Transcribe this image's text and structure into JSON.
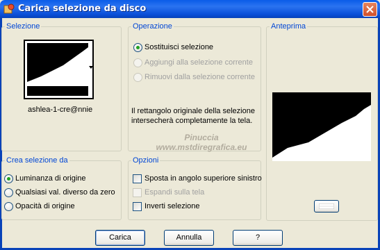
{
  "window": {
    "title": "Carica selezione da disco"
  },
  "selezione": {
    "label": "Selezione",
    "file_name": "ashlea-1-cre@nnie"
  },
  "operazione": {
    "label": "Operazione",
    "options": [
      {
        "label": "Sostituisci selezione",
        "checked": true,
        "enabled": true
      },
      {
        "label": "Aggiungi alla selezione corrente",
        "checked": false,
        "enabled": false
      },
      {
        "label": "Rimuovi dalla selezione corrente",
        "checked": false,
        "enabled": false
      }
    ],
    "info_line1": "Il rettangolo originale della selezione",
    "info_line2": "intersecherà completamente la tela."
  },
  "anteprima": {
    "label": "Anteprima"
  },
  "crea_da": {
    "label": "Crea selezione da",
    "options": [
      {
        "label": "Luminanza di origine",
        "checked": true
      },
      {
        "label": "Qualsiasi val. diverso da zero",
        "checked": false
      },
      {
        "label": "Opacità di origine",
        "checked": false
      }
    ]
  },
  "opzioni": {
    "label": "Opzioni",
    "items": [
      {
        "label": "Sposta in angolo superiore sinistro",
        "checked": false,
        "enabled": true
      },
      {
        "label": "Espandi sulla tela",
        "checked": false,
        "enabled": false
      },
      {
        "label": "Inverti selezione",
        "checked": false,
        "enabled": true
      }
    ]
  },
  "watermark": {
    "line1": "Pinuccia",
    "line2": "www.mstdiregrafica.eu"
  },
  "buttons": {
    "load": "Carica",
    "cancel": "Annulla",
    "help": "?"
  },
  "colors": {
    "titlebar": "#0a5ce8",
    "group_label": "#0046d5",
    "radio_dot": "#21a121"
  },
  "icons": {
    "app": "app-icon",
    "close": "close-icon",
    "dropdown": "dropdown-arrow-icon"
  }
}
